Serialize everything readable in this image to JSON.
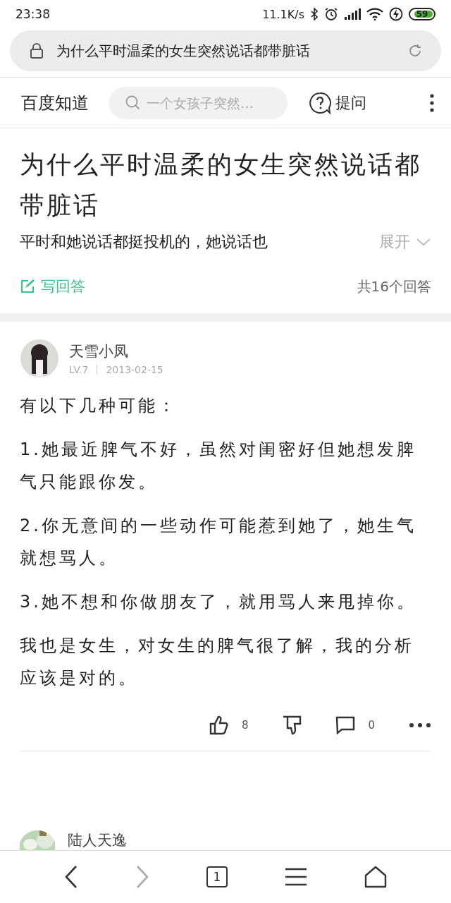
{
  "status_bar": {
    "time": "23:38",
    "net_speed": "11.1K/s",
    "battery": "59"
  },
  "address_bar": {
    "url_text": "为什么平时温柔的女生突然说话都带脏话"
  },
  "header": {
    "logo": "百度知道",
    "search": {
      "placeholder": "一个女孩子突然…"
    },
    "ask_label": "提问"
  },
  "question": {
    "title": "为什么平时温柔的女生突然说话都带脏话",
    "excerpt": "平时和她说话都挺投机的，她说话也",
    "expand_label": "展开",
    "write_answer": "写回答",
    "answer_count": "共16个回答"
  },
  "answers": [
    {
      "author": "天雪小凤",
      "level": "LV.7",
      "date": "2013-02-15",
      "paragraphs": [
        "有以下几种可能：",
        "1.她最近脾气不好，虽然对闺密好但她想发脾气只能跟你发。",
        "2.你无意间的一些动作可能惹到她了，她生气就想骂人。",
        "3.她不想和你做朋友了，就用骂人来甩掉你。",
        "我也是女生，对女生的脾气很了解，我的分析应该是对的。"
      ],
      "likes": "8",
      "comments": "0"
    },
    {
      "author": "陆人天逸"
    }
  ],
  "bottom_nav": {
    "tab_count": "1"
  }
}
